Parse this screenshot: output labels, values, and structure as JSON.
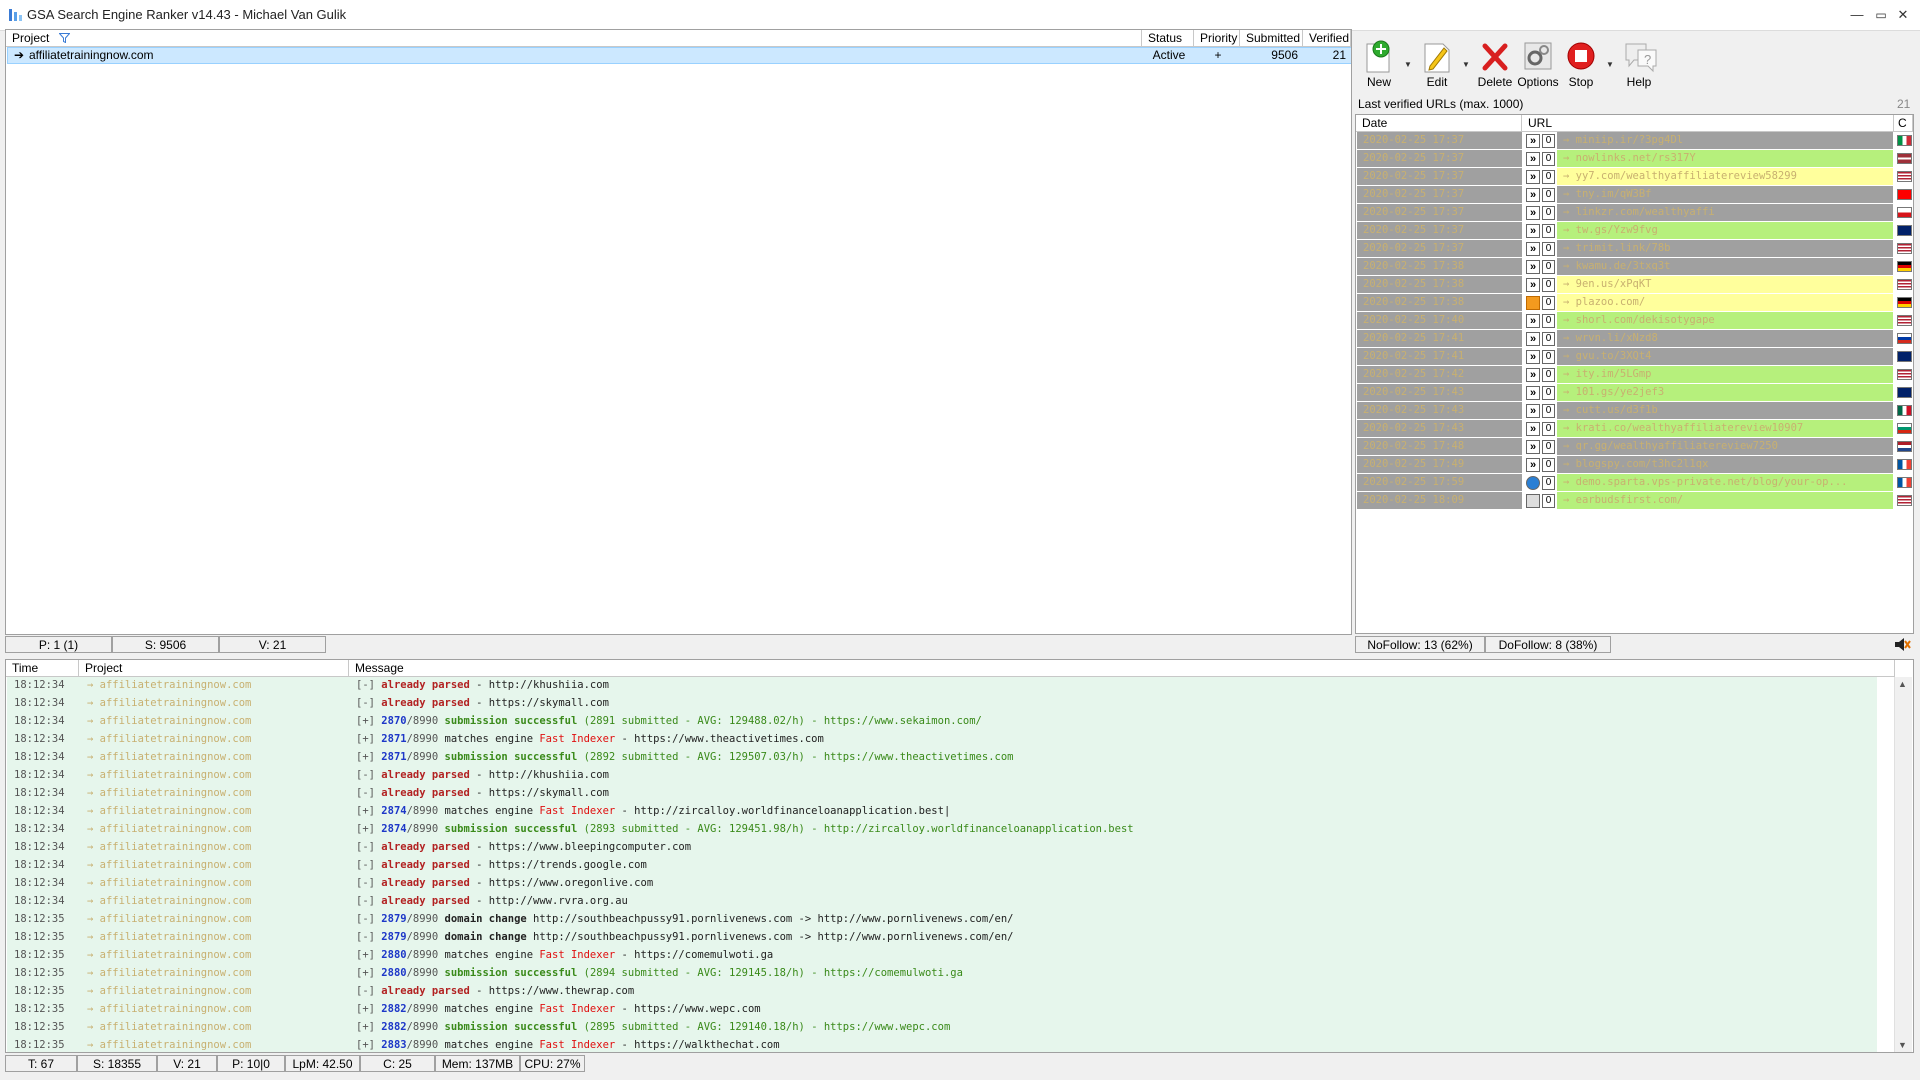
{
  "window": {
    "title": "GSA Search Engine Ranker v14.43 - Michael Van Gulik"
  },
  "projects": {
    "columns": {
      "project": "Project",
      "status": "Status",
      "priority": "Priority",
      "submitted": "Submitted",
      "verified": "Verified"
    },
    "rows": [
      {
        "name": "affiliatetrainingnow.com",
        "status": "Active",
        "priority": "+",
        "submitted": "9506",
        "verified": "21"
      }
    ],
    "statusbar": {
      "p": "P: 1 (1)",
      "s": "S: 9506",
      "v": "V: 21"
    }
  },
  "toolbar": {
    "new": "New",
    "edit": "Edit",
    "delete": "Delete",
    "options": "Options",
    "stop": "Stop",
    "help": "Help"
  },
  "verified_urls": {
    "caption": "Last verified URLs (max. 1000)",
    "count": "21",
    "columns": {
      "date": "Date",
      "url": "URL",
      "country": "C"
    },
    "rows": [
      {
        "date": "2020-02-25 17:37",
        "url": "→ miniip.ir/?3pg4Dl",
        "bg": "#a0a0a0",
        "icon": "»",
        "flag": "italy"
      },
      {
        "date": "2020-02-25 17:37",
        "url": "→ nowlinks.net/rs317Y",
        "bg": "#b6f07c",
        "icon": "»",
        "flag": "latvia"
      },
      {
        "date": "2020-02-25 17:37",
        "url": "→ yy7.com/wealthyaffiliatereview58299",
        "bg": "#ffff9c",
        "icon": "»",
        "flag": "usa"
      },
      {
        "date": "2020-02-25 17:37",
        "url": "→ tny.im/qW3Bf",
        "bg": "#a0a0a0",
        "icon": "»",
        "flag": "taiwan"
      },
      {
        "date": "2020-02-25 17:37",
        "url": "→ linkzr.com/wealthyaffi",
        "bg": "#a0a0a0",
        "icon": "»",
        "flag": "czech"
      },
      {
        "date": "2020-02-25 17:37",
        "url": "→ tw.gs/Yzw9fvg",
        "bg": "#b6f07c",
        "icon": "»",
        "flag": "australia"
      },
      {
        "date": "2020-02-25 17:37",
        "url": "→ trimit.link/78b",
        "bg": "#a0a0a0",
        "icon": "»",
        "flag": "usa"
      },
      {
        "date": "2020-02-25 17:38",
        "url": "→ kwamu.de/3txq3t",
        "bg": "#a0a0a0",
        "icon": "»",
        "flag": "germany"
      },
      {
        "date": "2020-02-25 17:38",
        "url": "→ 9en.us/xPqKT",
        "bg": "#ffff9c",
        "icon": "»",
        "flag": "usa"
      },
      {
        "date": "2020-02-25 17:38",
        "url": "→ plazoo.com/",
        "bg": "#ffff9c",
        "icon": "rss",
        "flag": "germany"
      },
      {
        "date": "2020-02-25 17:40",
        "url": "→ shorl.com/dekisotygape",
        "bg": "#b6f07c",
        "icon": "»",
        "flag": "usa"
      },
      {
        "date": "2020-02-25 17:41",
        "url": "→ wrvn.li/xNzd8",
        "bg": "#a0a0a0",
        "icon": "»",
        "flag": "russia"
      },
      {
        "date": "2020-02-25 17:41",
        "url": "→ gvu.to/3XQt4",
        "bg": "#a0a0a0",
        "icon": "»",
        "flag": "uk"
      },
      {
        "date": "2020-02-25 17:42",
        "url": "→ ity.im/5LGmp",
        "bg": "#b6f07c",
        "icon": "»",
        "flag": "usa"
      },
      {
        "date": "2020-02-25 17:43",
        "url": "→ 101.gs/ye2jef3",
        "bg": "#b6f07c",
        "icon": "»",
        "flag": "australia"
      },
      {
        "date": "2020-02-25 17:43",
        "url": "→ cutt.us/d3f1b",
        "bg": "#a0a0a0",
        "icon": "»",
        "flag": "mexico"
      },
      {
        "date": "2020-02-25 17:43",
        "url": "→ krati.co/wealthyaffiliatereview10907",
        "bg": "#b6f07c",
        "icon": "»",
        "flag": "bulgaria"
      },
      {
        "date": "2020-02-25 17:48",
        "url": "→ qr.gg/wealthyaffiliatereview7250",
        "bg": "#a0a0a0",
        "icon": "»",
        "flag": "netherlands"
      },
      {
        "date": "2020-02-25 17:49",
        "url": "→ blogspy.com/t3hc2l1qx",
        "bg": "#a0a0a0",
        "icon": "»",
        "flag": "france"
      },
      {
        "date": "2020-02-25 17:59",
        "url": "→ demo.sparta.vps-private.net/blog/your-op...",
        "bg": "#b6f07c",
        "icon": "web",
        "flag": "france"
      },
      {
        "date": "2020-02-25 18:09",
        "url": "→ earbudsfirst.com/",
        "bg": "#b6f07c",
        "icon": "img",
        "flag": "usa"
      }
    ],
    "statusbar": {
      "nofollow": "NoFollow: 13 (62%)",
      "dofollow": "DoFollow: 8 (38%)"
    }
  },
  "log": {
    "columns": {
      "time": "Time",
      "project": "Project",
      "message": "Message"
    },
    "rows": [
      {
        "time": "18:12:34",
        "project": "→ affiliatetrainingnow.com",
        "parts": [
          [
            "m-pre",
            "[-] "
          ],
          [
            "m-red",
            "already parsed"
          ],
          [
            "m-blk",
            " - http://khushiia.com"
          ]
        ]
      },
      {
        "time": "18:12:34",
        "project": "→ affiliatetrainingnow.com",
        "parts": [
          [
            "m-pre",
            "[-] "
          ],
          [
            "m-red",
            "already parsed"
          ],
          [
            "m-blk",
            " - https://skymall.com"
          ]
        ]
      },
      {
        "time": "18:12:34",
        "project": "→ affiliatetrainingnow.com",
        "parts": [
          [
            "m-pre",
            "[+] "
          ],
          [
            "m-blu",
            "2870"
          ],
          [
            "m-pre",
            "/8990 "
          ],
          [
            "m-grnb",
            "submission successful"
          ],
          [
            "m-grn",
            " (2891 submitted - AVG: 129488.02/h) - https://www.sekaimon.com/"
          ]
        ]
      },
      {
        "time": "18:12:34",
        "project": "→ affiliatetrainingnow.com",
        "parts": [
          [
            "m-pre",
            "[+] "
          ],
          [
            "m-blu",
            "2871"
          ],
          [
            "m-pre",
            "/8990 "
          ],
          [
            "m-blk",
            "matches engine "
          ],
          [
            "m-idx",
            "Fast Indexer"
          ],
          [
            "m-blk",
            " - https://www.theactivetimes.com"
          ]
        ]
      },
      {
        "time": "18:12:34",
        "project": "→ affiliatetrainingnow.com",
        "parts": [
          [
            "m-pre",
            "[+] "
          ],
          [
            "m-blu",
            "2871"
          ],
          [
            "m-pre",
            "/8990 "
          ],
          [
            "m-grnb",
            "submission successful"
          ],
          [
            "m-grn",
            " (2892 submitted - AVG: 129507.03/h) - https://www.theactivetimes.com"
          ]
        ]
      },
      {
        "time": "18:12:34",
        "project": "→ affiliatetrainingnow.com",
        "parts": [
          [
            "m-pre",
            "[-] "
          ],
          [
            "m-red",
            "already parsed"
          ],
          [
            "m-blk",
            " - http://khushiia.com"
          ]
        ]
      },
      {
        "time": "18:12:34",
        "project": "→ affiliatetrainingnow.com",
        "parts": [
          [
            "m-pre",
            "[-] "
          ],
          [
            "m-red",
            "already parsed"
          ],
          [
            "m-blk",
            " - https://skymall.com"
          ]
        ]
      },
      {
        "time": "18:12:34",
        "project": "→ affiliatetrainingnow.com",
        "parts": [
          [
            "m-pre",
            "[+] "
          ],
          [
            "m-blu",
            "2874"
          ],
          [
            "m-pre",
            "/8990 "
          ],
          [
            "m-blk",
            "matches engine "
          ],
          [
            "m-idx",
            "Fast Indexer"
          ],
          [
            "m-blk",
            " - http://zircalloy.worldfinanceloanapplication.best|"
          ]
        ]
      },
      {
        "time": "18:12:34",
        "project": "→ affiliatetrainingnow.com",
        "parts": [
          [
            "m-pre",
            "[+] "
          ],
          [
            "m-blu",
            "2874"
          ],
          [
            "m-pre",
            "/8990 "
          ],
          [
            "m-grnb",
            "submission successful"
          ],
          [
            "m-grn",
            " (2893 submitted - AVG: 129451.98/h) - http://zircalloy.worldfinanceloanapplication.best"
          ]
        ]
      },
      {
        "time": "18:12:34",
        "project": "→ affiliatetrainingnow.com",
        "parts": [
          [
            "m-pre",
            "[-] "
          ],
          [
            "m-red",
            "already parsed"
          ],
          [
            "m-blk",
            " - https://www.bleepingcomputer.com"
          ]
        ]
      },
      {
        "time": "18:12:34",
        "project": "→ affiliatetrainingnow.com",
        "parts": [
          [
            "m-pre",
            "[-] "
          ],
          [
            "m-red",
            "already parsed"
          ],
          [
            "m-blk",
            " - https://trends.google.com"
          ]
        ]
      },
      {
        "time": "18:12:34",
        "project": "→ affiliatetrainingnow.com",
        "parts": [
          [
            "m-pre",
            "[-] "
          ],
          [
            "m-red",
            "already parsed"
          ],
          [
            "m-blk",
            " - https://www.oregonlive.com"
          ]
        ]
      },
      {
        "time": "18:12:34",
        "project": "→ affiliatetrainingnow.com",
        "parts": [
          [
            "m-pre",
            "[-] "
          ],
          [
            "m-red",
            "already parsed"
          ],
          [
            "m-blk",
            " - http://www.rvra.org.au"
          ]
        ]
      },
      {
        "time": "18:12:35",
        "project": "→ affiliatetrainingnow.com",
        "parts": [
          [
            "m-pre",
            "[-] "
          ],
          [
            "m-blu",
            "2879"
          ],
          [
            "m-pre",
            "/8990 "
          ],
          [
            "m-bold",
            "domain change"
          ],
          [
            "m-blk",
            " http://southbeachpussy91.pornlivenews.com -> http://www.pornlivenews.com/en/"
          ]
        ]
      },
      {
        "time": "18:12:35",
        "project": "→ affiliatetrainingnow.com",
        "parts": [
          [
            "m-pre",
            "[-] "
          ],
          [
            "m-blu",
            "2879"
          ],
          [
            "m-pre",
            "/8990 "
          ],
          [
            "m-bold",
            "domain change"
          ],
          [
            "m-blk",
            " http://southbeachpussy91.pornlivenews.com -> http://www.pornlivenews.com/en/"
          ]
        ]
      },
      {
        "time": "18:12:35",
        "project": "→ affiliatetrainingnow.com",
        "parts": [
          [
            "m-pre",
            "[+] "
          ],
          [
            "m-blu",
            "2880"
          ],
          [
            "m-pre",
            "/8990 "
          ],
          [
            "m-blk",
            "matches engine "
          ],
          [
            "m-idx",
            "Fast Indexer"
          ],
          [
            "m-blk",
            " - https://comemulwoti.ga"
          ]
        ]
      },
      {
        "time": "18:12:35",
        "project": "→ affiliatetrainingnow.com",
        "parts": [
          [
            "m-pre",
            "[+] "
          ],
          [
            "m-blu",
            "2880"
          ],
          [
            "m-pre",
            "/8990 "
          ],
          [
            "m-grnb",
            "submission successful"
          ],
          [
            "m-grn",
            " (2894 submitted - AVG: 129145.18/h) - https://comemulwoti.ga"
          ]
        ]
      },
      {
        "time": "18:12:35",
        "project": "→ affiliatetrainingnow.com",
        "parts": [
          [
            "m-pre",
            "[-] "
          ],
          [
            "m-red",
            "already parsed"
          ],
          [
            "m-blk",
            " - https://www.thewrap.com"
          ]
        ]
      },
      {
        "time": "18:12:35",
        "project": "→ affiliatetrainingnow.com",
        "parts": [
          [
            "m-pre",
            "[+] "
          ],
          [
            "m-blu",
            "2882"
          ],
          [
            "m-pre",
            "/8990 "
          ],
          [
            "m-blk",
            "matches engine "
          ],
          [
            "m-idx",
            "Fast Indexer"
          ],
          [
            "m-blk",
            " - https://www.wepc.com"
          ]
        ]
      },
      {
        "time": "18:12:35",
        "project": "→ affiliatetrainingnow.com",
        "parts": [
          [
            "m-pre",
            "[+] "
          ],
          [
            "m-blu",
            "2882"
          ],
          [
            "m-pre",
            "/8990 "
          ],
          [
            "m-grnb",
            "submission successful"
          ],
          [
            "m-grn",
            " (2895 submitted - AVG: 129140.18/h) - https://www.wepc.com"
          ]
        ]
      },
      {
        "time": "18:12:35",
        "project": "→ affiliatetrainingnow.com",
        "parts": [
          [
            "m-pre",
            "[+] "
          ],
          [
            "m-blu",
            "2883"
          ],
          [
            "m-pre",
            "/8990 "
          ],
          [
            "m-blk",
            "matches engine "
          ],
          [
            "m-idx",
            "Fast Indexer"
          ],
          [
            "m-blk",
            " - https://walkthechat.com"
          ]
        ]
      }
    ]
  },
  "statusbar": {
    "threads": "T: 67",
    "submitted": "S: 18355",
    "verified": "V: 21",
    "proxies": "P: 10|0",
    "lpm": "LpM: 42.50",
    "captcha": "C: 25",
    "mem": "Mem: 137MB",
    "cpu": "CPU: 27%"
  }
}
